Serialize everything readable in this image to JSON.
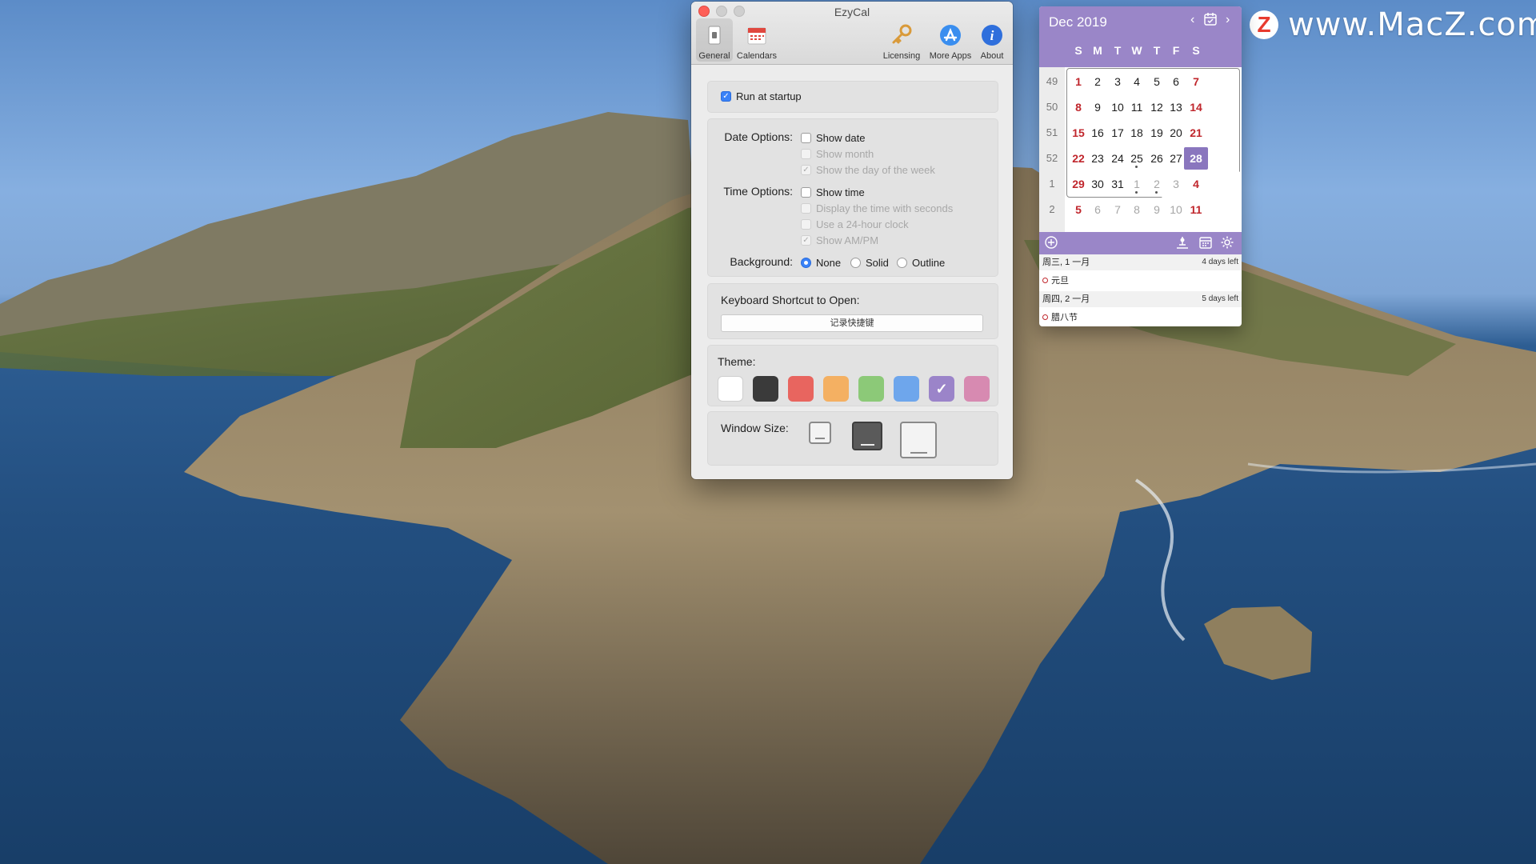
{
  "watermark": {
    "logo": "Z",
    "text": "www.MacZ.com"
  },
  "prefs": {
    "title": "EzyCal",
    "toolbar": [
      {
        "label": "General",
        "icon": "general-icon",
        "active": true
      },
      {
        "label": "Calendars",
        "icon": "calendar-icon",
        "active": false
      },
      {
        "label": "Licensing",
        "icon": "key-icon",
        "active": false
      },
      {
        "label": "More Apps",
        "icon": "app-store-icon",
        "active": false
      },
      {
        "label": "About",
        "icon": "info-icon",
        "active": false
      }
    ],
    "run_at_startup": {
      "label": "Run at startup",
      "checked": true
    },
    "date_options": {
      "label": "Date Options:",
      "items": [
        {
          "label": "Show date",
          "checked": false,
          "enabled": true
        },
        {
          "label": "Show month",
          "checked": false,
          "enabled": false
        },
        {
          "label": "Show the day of the week",
          "checked": true,
          "enabled": false
        }
      ]
    },
    "time_options": {
      "label": "Time Options:",
      "items": [
        {
          "label": "Show time",
          "checked": false,
          "enabled": true
        },
        {
          "label": "Display the time with seconds",
          "checked": false,
          "enabled": false
        },
        {
          "label": "Use a 24-hour clock",
          "checked": false,
          "enabled": false
        },
        {
          "label": "Show AM/PM",
          "checked": true,
          "enabled": false
        }
      ]
    },
    "background": {
      "label": "Background:",
      "options": [
        "None",
        "Solid",
        "Outline"
      ],
      "selected": "None"
    },
    "shortcut": {
      "label": "Keyboard Shortcut to Open:",
      "button": "记录快捷键"
    },
    "theme": {
      "label": "Theme:",
      "colors": [
        "#ffffff",
        "#3a3a3a",
        "#e8655f",
        "#f4b062",
        "#8cc978",
        "#6ea6ec",
        "#9b84c9",
        "#d78ab1"
      ],
      "selected_index": 6
    },
    "window_size": {
      "label": "Window Size:",
      "options": [
        "small",
        "medium",
        "large"
      ],
      "selected_index": 1
    }
  },
  "calendar": {
    "month": "Dec 2019",
    "weekdays": [
      "S",
      "M",
      "T",
      "W",
      "T",
      "F",
      "S"
    ],
    "week_numbers": [
      "49",
      "50",
      "51",
      "52",
      "1",
      "2"
    ],
    "weeks": [
      [
        "1",
        "2",
        "3",
        "4",
        "5",
        "6",
        "7"
      ],
      [
        "8",
        "9",
        "10",
        "11",
        "12",
        "13",
        "14"
      ],
      [
        "15",
        "16",
        "17",
        "18",
        "19",
        "20",
        "21"
      ],
      [
        "22",
        "23",
        "24",
        "25",
        "26",
        "27",
        "28"
      ],
      [
        "29",
        "30",
        "31",
        "1",
        "2",
        "3",
        "4"
      ],
      [
        "5",
        "6",
        "7",
        "8",
        "9",
        "10",
        "11"
      ]
    ],
    "today": "28",
    "events": [
      {
        "day": "周三, 1 一月",
        "left": "4 days left",
        "title": "元旦"
      },
      {
        "day": "周四, 2 一月",
        "left": "5 days left",
        "title": "腊八节"
      }
    ]
  }
}
